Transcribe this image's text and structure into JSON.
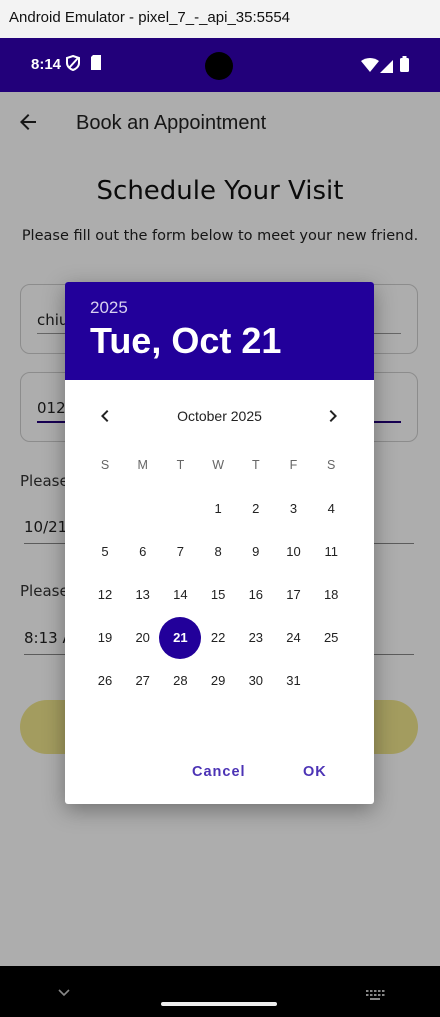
{
  "window": {
    "title": "Android Emulator - pixel_7_-_api_35:5554"
  },
  "status_bar": {
    "time": "8:14",
    "icons": [
      "vpn-icon",
      "sim-card-icon",
      "wifi-icon",
      "signal-icon",
      "battery-icon"
    ]
  },
  "app_bar": {
    "title": "Book an Appointment",
    "back_icon": "arrow-back-icon"
  },
  "form": {
    "heading": "Schedule Your Visit",
    "subheading": "Please fill out the form below to meet your new friend.",
    "name_value": "chiu",
    "phone_value": "012",
    "date_label": "Please",
    "date_value": "10/21",
    "time_label": "Please",
    "time_value": "8:13 A"
  },
  "date_picker": {
    "year": "2025",
    "selected_date": "Tue, Oct 21",
    "month_label": "October 2025",
    "prev_icon": "chevron-left-icon",
    "next_icon": "chevron-right-icon",
    "weekdays": [
      "S",
      "M",
      "T",
      "W",
      "T",
      "F",
      "S"
    ],
    "first_weekday_index": 3,
    "days_in_month": 31,
    "selected_day": 21,
    "cancel_label": "Cancel",
    "ok_label": "OK"
  },
  "colors": {
    "primary": "#22009a",
    "accent_text": "#4c33b5",
    "status_bar": "#22007a",
    "button_bg": "#f0e68c"
  },
  "nav_bar": {
    "icons": [
      "chevron-down-icon",
      "keyboard-icon"
    ]
  }
}
